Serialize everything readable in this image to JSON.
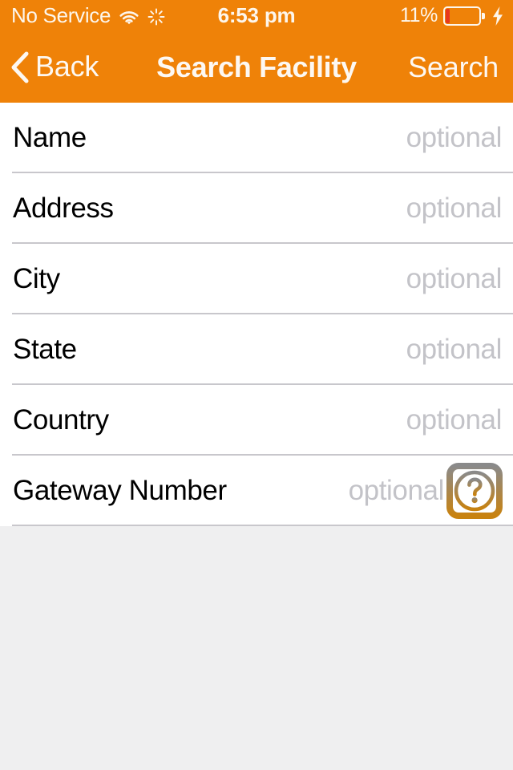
{
  "status_bar": {
    "carrier": "No Service",
    "wifi_icon": "wifi-icon",
    "activity_icon": "spinner-icon",
    "time": "6:53 pm",
    "battery_percent_label": "11%",
    "battery_level": 11,
    "battery_icon": "battery-icon",
    "charging_icon": "lightning-bolt-icon",
    "charging": true
  },
  "nav_bar": {
    "back_label": "Back",
    "back_icon": "chevron-left-icon",
    "title": "Search Facility",
    "action_label": "Search"
  },
  "form": {
    "rows": [
      {
        "label": "Name",
        "value": "",
        "placeholder": "optional",
        "help": false
      },
      {
        "label": "Address",
        "value": "",
        "placeholder": "optional",
        "help": false
      },
      {
        "label": "City",
        "value": "",
        "placeholder": "optional",
        "help": false
      },
      {
        "label": "State",
        "value": "",
        "placeholder": "optional",
        "help": false
      },
      {
        "label": "Country",
        "value": "",
        "placeholder": "optional",
        "help": false
      },
      {
        "label": "Gateway Number",
        "value": "",
        "placeholder": "optional",
        "help": true,
        "help_icon": "question-mark-help-icon"
      }
    ]
  },
  "colors": {
    "accent_orange": "#ef8208",
    "nav_text": "#fdf8f2",
    "label_text": "#000000",
    "placeholder_text": "#c3c3c8",
    "separator": "#c8c7cc",
    "page_background": "#efeff0",
    "list_background": "#ffffff",
    "battery_low": "#e8381f",
    "help_icon_top": "#8a8a8a",
    "help_icon_bottom": "#c8820f"
  }
}
